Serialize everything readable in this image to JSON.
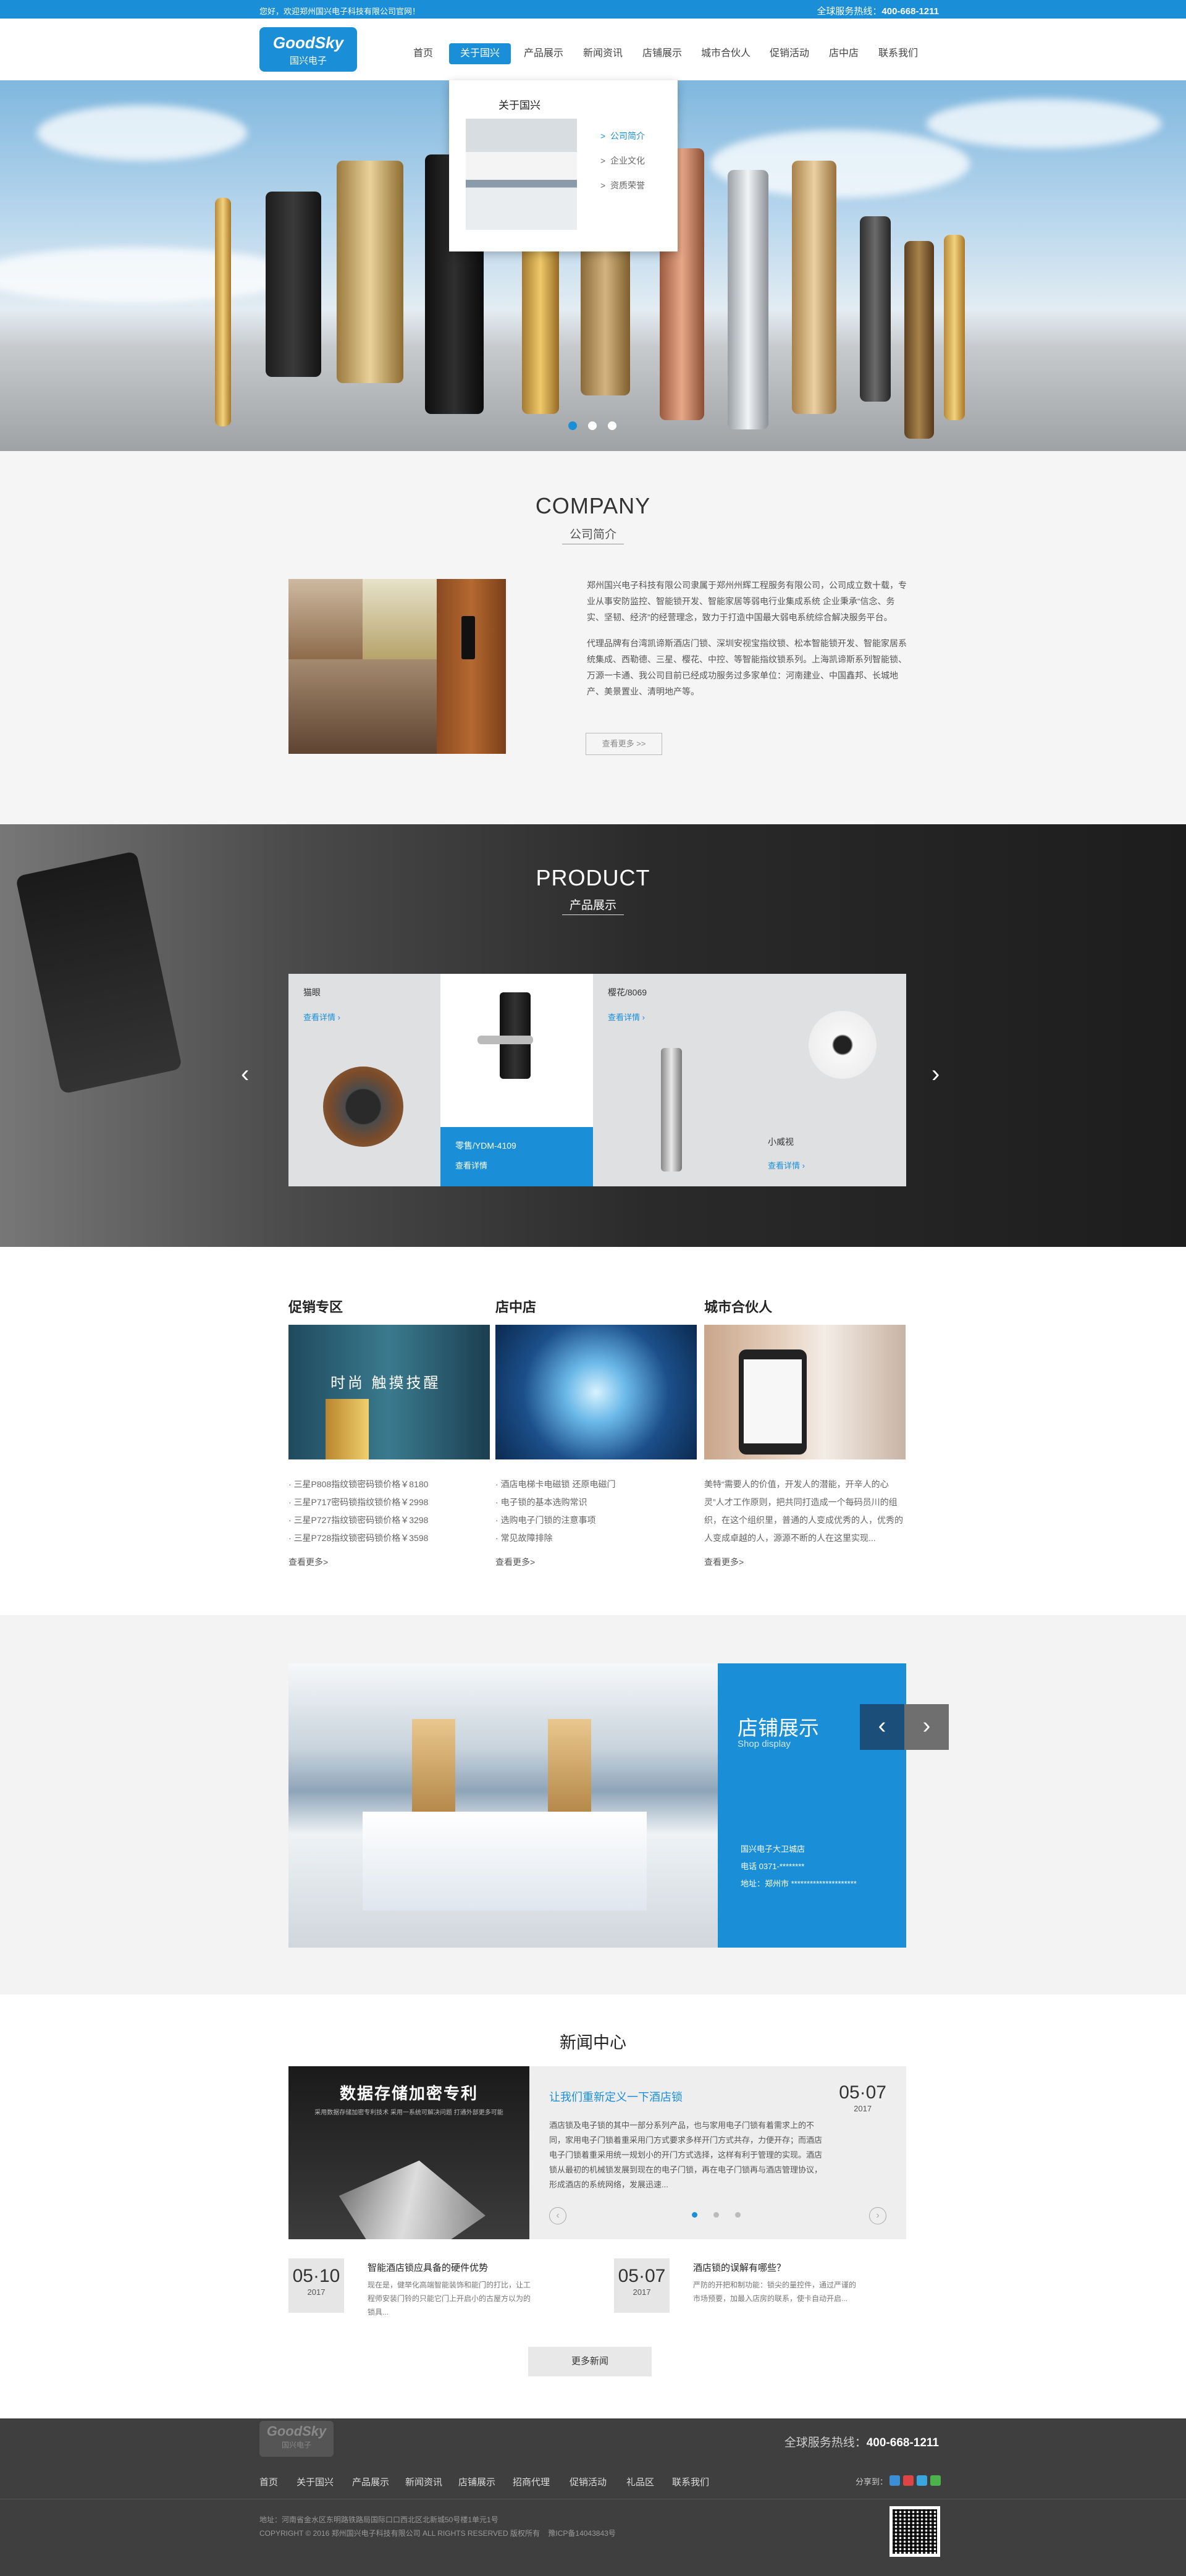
{
  "topbar": {
    "welcome": "您好，欢迎郑州国兴电子科技有限公司官网！",
    "hotline_label": "全球服务热线：",
    "hotline": "400-668-1211"
  },
  "logo": {
    "en": "GoodSky",
    "cn": "国兴电子"
  },
  "nav": {
    "items": [
      {
        "label": "首页"
      },
      {
        "label": "关于国兴"
      },
      {
        "label": "产品展示"
      },
      {
        "label": "新闻资讯"
      },
      {
        "label": "店铺展示"
      },
      {
        "label": "城市合伙人"
      },
      {
        "label": "促销活动"
      },
      {
        "label": "店中店"
      },
      {
        "label": "联系我们"
      }
    ],
    "active": "关于国兴"
  },
  "dropdown": {
    "title": "关于国兴",
    "links": [
      "公司简介",
      "企业文化",
      "资质荣誉"
    ],
    "active": "公司简介"
  },
  "company": {
    "title_en": "COMPANY",
    "title_cn": "公司简介",
    "para1": "郑州国兴电子科技有限公司隶属于郑州州辉工程服务有限公司，公司成立数十载，专业从事安防监控、智能锁开发、智能家居等弱电行业集成系统 企业秉承“信念、务实、坚韧、经济”的经营理念，致力于打造中国最大弱电系统综合解决服务平台。",
    "para2": "代理品牌有台湾凯谛斯酒店门锁、深圳安视宝指纹锁、松本智能锁开发、智能家居系统集成、西勒德、三星、樱花、中控、等智能指纹锁系列。上海凯谛斯系列智能锁、万源一卡通、我公司目前已经成功服务过多家单位：河南建业、中国鑫邦、长城地产、美景置业、清明地产等。",
    "more": "查看更多 >>"
  },
  "product": {
    "title_en": "PRODUCT",
    "title_cn": "产品展示",
    "cards": [
      {
        "name": "猫眼",
        "link": "查看详情"
      },
      {
        "name": "零售/YDM-4109",
        "link": "查看详情"
      },
      {
        "name": "樱花/8069",
        "link": "查看详情"
      },
      {
        "name": "小威视",
        "link": "查看详情"
      }
    ],
    "prev": "‹",
    "next": "›"
  },
  "promo": {
    "title": "促销专区",
    "banner_text": "时尚 触摸技醒",
    "items": [
      "三星P808指纹锁密码锁价格￥8180",
      "三星P717密码锁指纹锁价格￥2998",
      "三星P727指纹锁密码锁价格￥3298",
      "三星P728指纹锁密码锁价格￥3598"
    ],
    "more": "查看更多>"
  },
  "store": {
    "title": "店中店",
    "items": [
      "酒店电梯卡电磁锁 还原电磁门",
      "电子锁的基本选购常识",
      "选购电子门锁的注意事项",
      "常见故障排除"
    ],
    "more": "查看更多>"
  },
  "partner": {
    "title": "城市合伙人",
    "text": "美特“需要人的价值，开发人的潜能，开辛人的心灵”人才工作原则，把共同打造成一个每码员川的组织，在这个组织里，普通的人变成优秀的人，优秀的人变成卓越的人，源源不断的人在这里实现...",
    "more": "查看更多>"
  },
  "shop": {
    "title": "店铺展示",
    "subtitle": "Shop display",
    "name": "国兴电子大卫城店",
    "phone": "电话 0371-********",
    "address": "地址：郑州市 *********************",
    "prev": "‹",
    "next": "›"
  },
  "news": {
    "title": "新闻中心",
    "pic_title": "数据存储加密专利",
    "pic_sub": "采用数据存储加密专利技术 采用一系统可解决问题 打通外部更多可能",
    "featured": {
      "headline": "让我们重新定义一下酒店锁",
      "text": "酒店锁及电子锁的其中一部分系列产品，也与家用电子门锁有着需求上的不同，家用电子门锁着重采用门方式要求多样开门方式共存，力便开存；而酒店电子门锁着重采用统一规划小的开门方式选择，这样有利于管理的实现。酒店锁从最初的机械锁发展到现在的电子门锁，再在电子门锁再与酒店管理协议，形成酒店的系统网络，发展迅速...",
      "day": "05·07",
      "year": "2017"
    },
    "items": [
      {
        "day": "05·10",
        "year": "2017",
        "headline": "智能酒店锁应具备的硬件优势",
        "text": "现在是，健举化高端智能装饰和能门的打比，让工程师安装门铃的只能它门上开启小的古屋方以为的锁具..."
      },
      {
        "day": "05·07",
        "year": "2017",
        "headline": "酒店锁的误解有哪些？",
        "text": "严防的开把和制功能：锁尖的量控件，通过严谨的市场预要，加最入店房的联系，使卡自动开启..."
      }
    ],
    "more": "更多新闻",
    "prev": "‹",
    "next": "›"
  },
  "footer": {
    "logo_en": "GoodSky",
    "logo_cn": "国兴电子",
    "hotline_label": "全球服务热线：",
    "hotline": "400-668-1211",
    "nav": [
      "首页",
      "关于国兴",
      "产品展示",
      "新闻资讯",
      "店铺展示",
      "招商代理",
      "促销活动",
      "礼品区",
      "联系我们"
    ],
    "share": "分享到：",
    "address": "地址：河南省金水区东明路铁路局国际口口西北区北新城50号楼1单元1号",
    "copyright": "COPYRIGHT © 2016 郑州国兴电子科技有限公司 ALL RIGHTS RESERVED 版权所有",
    "icp": "豫ICP备14043843号"
  }
}
